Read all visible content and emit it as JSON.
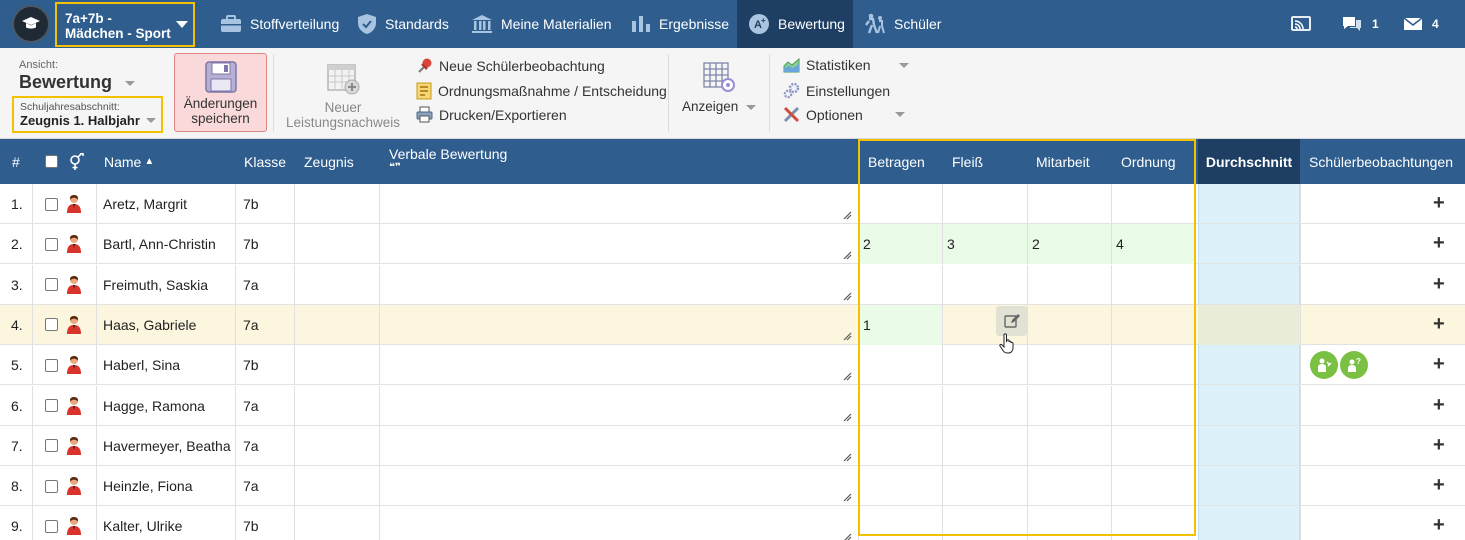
{
  "colors": {
    "nav": "#2e5d8e",
    "nav_active": "#1e3f63",
    "highlight_frame": "#f2c200",
    "save_bg": "#f9d9d9",
    "avg_col": "#ddf1fb",
    "filled_grade": "#eafbe7",
    "selected_row": "#fcf6df"
  },
  "topnav": {
    "class_selector": {
      "line1": "7a+7b -",
      "line2": "Mädchen - Sport",
      "icon": "chevron-down-icon"
    },
    "items": [
      {
        "label": "Stoffverteilung",
        "icon": "briefcase-icon"
      },
      {
        "label": "Standards",
        "icon": "shield-check-icon"
      },
      {
        "label": "Meine Materialien",
        "icon": "institution-icon"
      },
      {
        "label": "Ergebnisse",
        "icon": "bar-chart-icon"
      },
      {
        "label": "Bewertung",
        "icon": "grade-a-plus-icon",
        "active": true
      },
      {
        "label": "Schüler",
        "icon": "students-walking-icon"
      }
    ],
    "right": {
      "screen_icon": "cast-screen-icon",
      "messages_count": "1",
      "mail_count": "4"
    }
  },
  "toolbar": {
    "view_label": "Ansicht:",
    "view_value": "Bewertung",
    "period_label": "Schuljahresabschnitt:",
    "period_value": "Zeugnis 1. Halbjahr",
    "save_line1": "Änderungen",
    "save_line2": "speichern",
    "new_assessment_line1": "Neuer",
    "new_assessment_line2": "Leistungsnachweis",
    "new_observation": "Neue Schülerbeobachtung",
    "disciplinary": "Ordnungsmaßnahme / Entscheidung",
    "print_export": "Drucken/Exportieren",
    "display": "Anzeigen",
    "statistics": "Statistiken",
    "settings": "Einstellungen",
    "options": "Optionen"
  },
  "grid": {
    "headers": {
      "num": "#",
      "name": "Name",
      "sort_indicator": "▲",
      "class": "Klasse",
      "report": "Zeugnis",
      "verbal": "Verbale Bewertung",
      "verbal_sub": "❝❞",
      "behaviour": "Betragen",
      "diligence": "Fleiß",
      "participation": "Mitarbeit",
      "order": "Ordnung",
      "average": "Durchschnitt",
      "observations": "Schülerbeobachtungen"
    },
    "rows": [
      {
        "num": "1.",
        "name": "Aretz, Margrit",
        "class": "7b",
        "betragen": "",
        "fleiss": "",
        "mitarbeit": "",
        "ordnung": ""
      },
      {
        "num": "2.",
        "name": "Bartl, Ann-Christin",
        "class": "7b",
        "betragen": "2",
        "fleiss": "3",
        "mitarbeit": "2",
        "ordnung": "4"
      },
      {
        "num": "3.",
        "name": "Freimuth, Saskia",
        "class": "7a",
        "betragen": "",
        "fleiss": "",
        "mitarbeit": "",
        "ordnung": ""
      },
      {
        "num": "4.",
        "name": "Haas, Gabriele",
        "class": "7a",
        "betragen": "1",
        "fleiss": "",
        "mitarbeit": "",
        "ordnung": ""
      },
      {
        "num": "5.",
        "name": "Haberl, Sina",
        "class": "7b",
        "betragen": "",
        "fleiss": "",
        "mitarbeit": "",
        "ordnung": ""
      },
      {
        "num": "6.",
        "name": "Hagge, Ramona",
        "class": "7a",
        "betragen": "",
        "fleiss": "",
        "mitarbeit": "",
        "ordnung": ""
      },
      {
        "num": "7.",
        "name": "Havermeyer, Beatha",
        "class": "7a",
        "betragen": "",
        "fleiss": "",
        "mitarbeit": "",
        "ordnung": ""
      },
      {
        "num": "8.",
        "name": "Heinzle, Fiona",
        "class": "7a",
        "betragen": "",
        "fleiss": "",
        "mitarbeit": "",
        "ordnung": ""
      },
      {
        "num": "9.",
        "name": "Kalter, Ulrike",
        "class": "7b",
        "betragen": "",
        "fleiss": "",
        "mitarbeit": "",
        "ordnung": ""
      }
    ],
    "add_symbol": "+"
  }
}
